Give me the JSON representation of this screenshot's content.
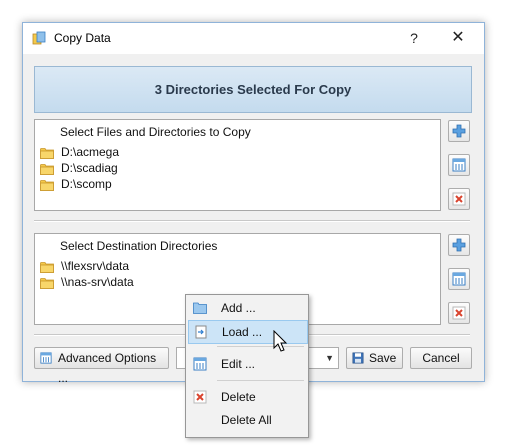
{
  "window": {
    "title": "Copy Data",
    "help_label": "?",
    "close_label": "✕"
  },
  "banner": {
    "text": "3 Directories Selected For Copy"
  },
  "source": {
    "title": "Select Files and Directories to Copy",
    "items": [
      {
        "label": "D:\\acmega"
      },
      {
        "label": "D:\\scadiag"
      },
      {
        "label": "D:\\scomp"
      }
    ]
  },
  "destination": {
    "title": "Select Destination Directories",
    "items": [
      {
        "label": "\\\\flexsrv\\data"
      },
      {
        "label": "\\\\nas-srv\\data"
      }
    ]
  },
  "footer": {
    "advanced_label": "Advanced Options ...",
    "combo_arrow": "▼",
    "save_label": "Save",
    "cancel_label": "Cancel"
  },
  "context_menu": {
    "items": [
      {
        "label": "Add ...",
        "icon": "folder-add-icon"
      },
      {
        "label": "Load ...",
        "icon": "load-icon",
        "highlighted": true
      },
      {
        "label": "Edit ...",
        "icon": "edit-icon"
      },
      {
        "label": "Delete",
        "icon": "delete-icon"
      },
      {
        "label": "Delete All"
      }
    ]
  },
  "colors": {
    "banner_bg": "#c4dbee",
    "accent_blue": "#2f7fd0",
    "delete_red": "#d9442f",
    "folder_yellow": "#f4c94a",
    "menu_highlight": "#cce4f7"
  }
}
